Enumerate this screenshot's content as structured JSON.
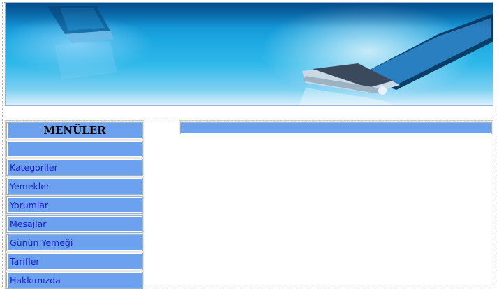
{
  "menu": {
    "title": "MENÜLER",
    "items": [
      {
        "label": "Kategoriler"
      },
      {
        "label": "Yemekler"
      },
      {
        "label": "Yorumlar"
      },
      {
        "label": "Mesajlar"
      },
      {
        "label": "Günün Yemeği"
      },
      {
        "label": "Tarifler"
      },
      {
        "label": "Hakkımızda"
      }
    ]
  },
  "colors": {
    "menu_bg": "#6ba1ef",
    "link": "#1a1ad4",
    "banner": "#1aa6e0"
  }
}
